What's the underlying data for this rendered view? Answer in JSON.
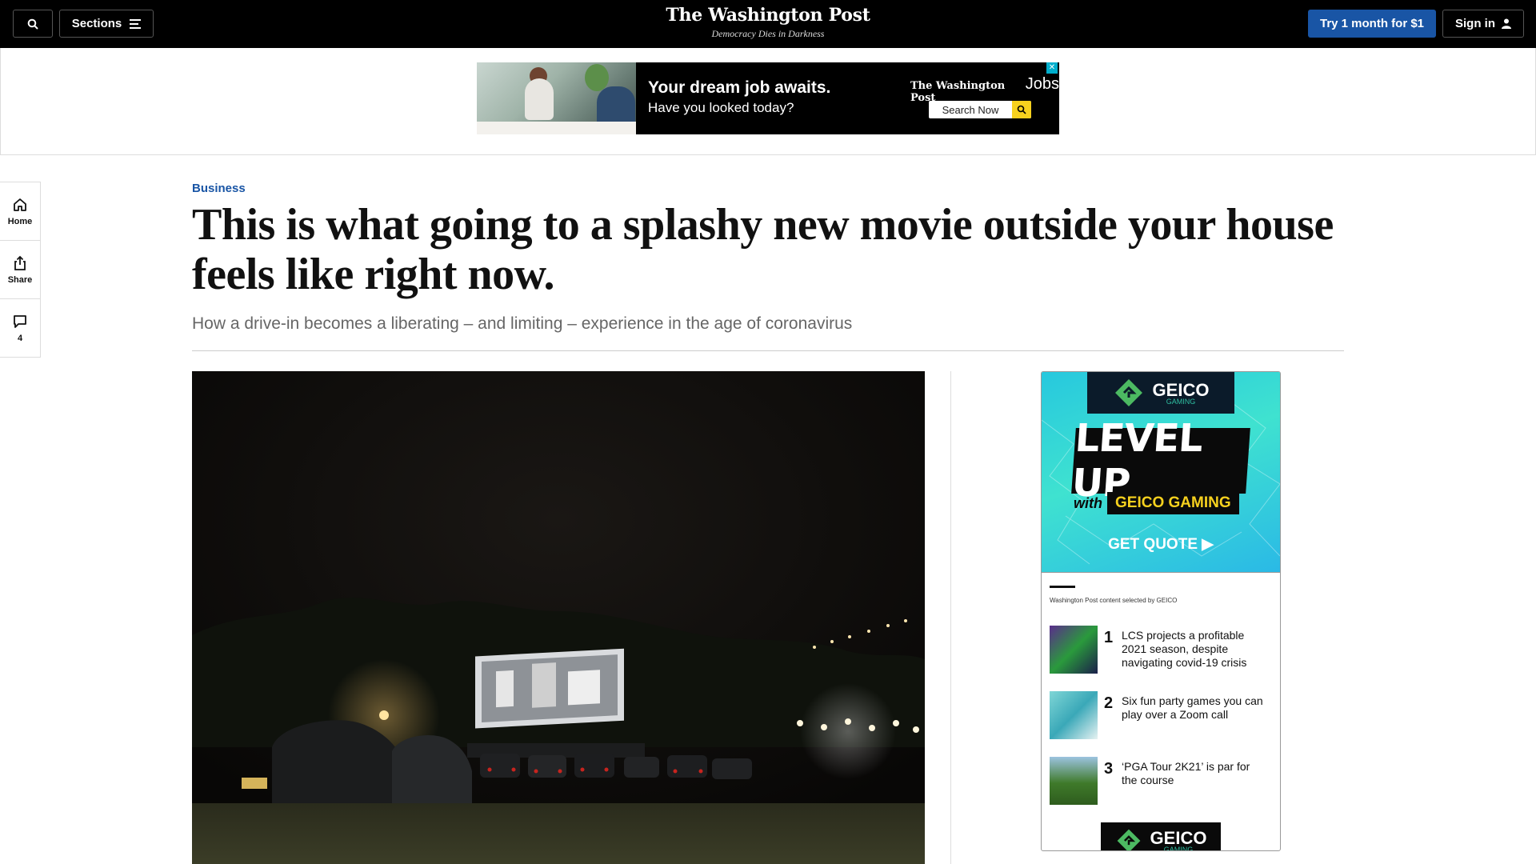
{
  "topbar": {
    "sections_label": "Sections",
    "logo": "The Washington Post",
    "tagline": "Democracy Dies in Darkness",
    "try_label": "Try 1 month for $1",
    "signin_label": "Sign in"
  },
  "top_ad": {
    "headline": "Your dream job awaits.",
    "subline": "Have you looked today?",
    "brand": "The Washington Post",
    "brand_suffix": "Jobs",
    "search_label": "Search Now"
  },
  "rail": {
    "home_label": "Home",
    "share_label": "Share",
    "comments_count": "4"
  },
  "article": {
    "kicker": "Business",
    "headline": "This is what going to a splashy new movie outside your house feels like right now.",
    "dek": "How a drive-in becomes a liberating – and limiting – experience in the age of coronavirus"
  },
  "side_ad": {
    "brand": "GEICO",
    "brand_sub": "GAMING",
    "level_up": "LEVEL UP",
    "with": "with",
    "geico_gaming": "GEICO GAMING",
    "get_quote": "GET QUOTE ▶",
    "selected_by": "Washington Post content selected by GEICO",
    "items": [
      {
        "num": "1",
        "text": "LCS projects a profitable 2021 season, despite navigating covid-19 crisis"
      },
      {
        "num": "2",
        "text": "Six fun party games you can play over a Zoom call"
      },
      {
        "num": "3",
        "text": "‘PGA Tour 2K21’ is par for the course"
      }
    ]
  },
  "colors": {
    "accent": "#1955a5",
    "topbar_bg": "#000000",
    "geico_teal": "#27c8de"
  },
  "icons": [
    "search-icon",
    "menu-icon",
    "user-icon",
    "home-icon",
    "share-icon",
    "comment-icon",
    "magnifier-icon",
    "adchoices-icon",
    "geico-gecko-icon"
  ]
}
